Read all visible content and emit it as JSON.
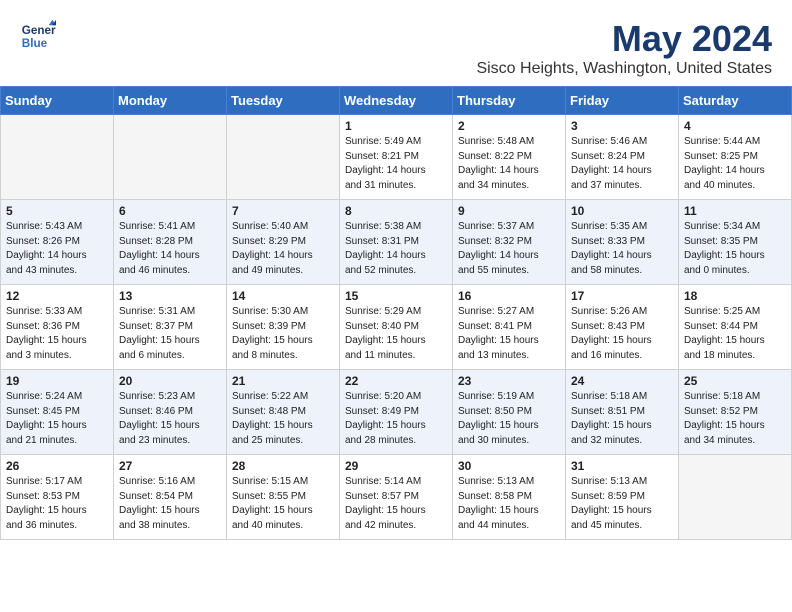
{
  "header": {
    "logo_line1": "General",
    "logo_line2": "Blue",
    "month": "May 2024",
    "location": "Sisco Heights, Washington, United States"
  },
  "days_of_week": [
    "Sunday",
    "Monday",
    "Tuesday",
    "Wednesday",
    "Thursday",
    "Friday",
    "Saturday"
  ],
  "weeks": [
    [
      {
        "day": "",
        "info": ""
      },
      {
        "day": "",
        "info": ""
      },
      {
        "day": "",
        "info": ""
      },
      {
        "day": "1",
        "info": "Sunrise: 5:49 AM\nSunset: 8:21 PM\nDaylight: 14 hours\nand 31 minutes."
      },
      {
        "day": "2",
        "info": "Sunrise: 5:48 AM\nSunset: 8:22 PM\nDaylight: 14 hours\nand 34 minutes."
      },
      {
        "day": "3",
        "info": "Sunrise: 5:46 AM\nSunset: 8:24 PM\nDaylight: 14 hours\nand 37 minutes."
      },
      {
        "day": "4",
        "info": "Sunrise: 5:44 AM\nSunset: 8:25 PM\nDaylight: 14 hours\nand 40 minutes."
      }
    ],
    [
      {
        "day": "5",
        "info": "Sunrise: 5:43 AM\nSunset: 8:26 PM\nDaylight: 14 hours\nand 43 minutes."
      },
      {
        "day": "6",
        "info": "Sunrise: 5:41 AM\nSunset: 8:28 PM\nDaylight: 14 hours\nand 46 minutes."
      },
      {
        "day": "7",
        "info": "Sunrise: 5:40 AM\nSunset: 8:29 PM\nDaylight: 14 hours\nand 49 minutes."
      },
      {
        "day": "8",
        "info": "Sunrise: 5:38 AM\nSunset: 8:31 PM\nDaylight: 14 hours\nand 52 minutes."
      },
      {
        "day": "9",
        "info": "Sunrise: 5:37 AM\nSunset: 8:32 PM\nDaylight: 14 hours\nand 55 minutes."
      },
      {
        "day": "10",
        "info": "Sunrise: 5:35 AM\nSunset: 8:33 PM\nDaylight: 14 hours\nand 58 minutes."
      },
      {
        "day": "11",
        "info": "Sunrise: 5:34 AM\nSunset: 8:35 PM\nDaylight: 15 hours\nand 0 minutes."
      }
    ],
    [
      {
        "day": "12",
        "info": "Sunrise: 5:33 AM\nSunset: 8:36 PM\nDaylight: 15 hours\nand 3 minutes."
      },
      {
        "day": "13",
        "info": "Sunrise: 5:31 AM\nSunset: 8:37 PM\nDaylight: 15 hours\nand 6 minutes."
      },
      {
        "day": "14",
        "info": "Sunrise: 5:30 AM\nSunset: 8:39 PM\nDaylight: 15 hours\nand 8 minutes."
      },
      {
        "day": "15",
        "info": "Sunrise: 5:29 AM\nSunset: 8:40 PM\nDaylight: 15 hours\nand 11 minutes."
      },
      {
        "day": "16",
        "info": "Sunrise: 5:27 AM\nSunset: 8:41 PM\nDaylight: 15 hours\nand 13 minutes."
      },
      {
        "day": "17",
        "info": "Sunrise: 5:26 AM\nSunset: 8:43 PM\nDaylight: 15 hours\nand 16 minutes."
      },
      {
        "day": "18",
        "info": "Sunrise: 5:25 AM\nSunset: 8:44 PM\nDaylight: 15 hours\nand 18 minutes."
      }
    ],
    [
      {
        "day": "19",
        "info": "Sunrise: 5:24 AM\nSunset: 8:45 PM\nDaylight: 15 hours\nand 21 minutes."
      },
      {
        "day": "20",
        "info": "Sunrise: 5:23 AM\nSunset: 8:46 PM\nDaylight: 15 hours\nand 23 minutes."
      },
      {
        "day": "21",
        "info": "Sunrise: 5:22 AM\nSunset: 8:48 PM\nDaylight: 15 hours\nand 25 minutes."
      },
      {
        "day": "22",
        "info": "Sunrise: 5:20 AM\nSunset: 8:49 PM\nDaylight: 15 hours\nand 28 minutes."
      },
      {
        "day": "23",
        "info": "Sunrise: 5:19 AM\nSunset: 8:50 PM\nDaylight: 15 hours\nand 30 minutes."
      },
      {
        "day": "24",
        "info": "Sunrise: 5:18 AM\nSunset: 8:51 PM\nDaylight: 15 hours\nand 32 minutes."
      },
      {
        "day": "25",
        "info": "Sunrise: 5:18 AM\nSunset: 8:52 PM\nDaylight: 15 hours\nand 34 minutes."
      }
    ],
    [
      {
        "day": "26",
        "info": "Sunrise: 5:17 AM\nSunset: 8:53 PM\nDaylight: 15 hours\nand 36 minutes."
      },
      {
        "day": "27",
        "info": "Sunrise: 5:16 AM\nSunset: 8:54 PM\nDaylight: 15 hours\nand 38 minutes."
      },
      {
        "day": "28",
        "info": "Sunrise: 5:15 AM\nSunset: 8:55 PM\nDaylight: 15 hours\nand 40 minutes."
      },
      {
        "day": "29",
        "info": "Sunrise: 5:14 AM\nSunset: 8:57 PM\nDaylight: 15 hours\nand 42 minutes."
      },
      {
        "day": "30",
        "info": "Sunrise: 5:13 AM\nSunset: 8:58 PM\nDaylight: 15 hours\nand 44 minutes."
      },
      {
        "day": "31",
        "info": "Sunrise: 5:13 AM\nSunset: 8:59 PM\nDaylight: 15 hours\nand 45 minutes."
      },
      {
        "day": "",
        "info": ""
      }
    ]
  ]
}
